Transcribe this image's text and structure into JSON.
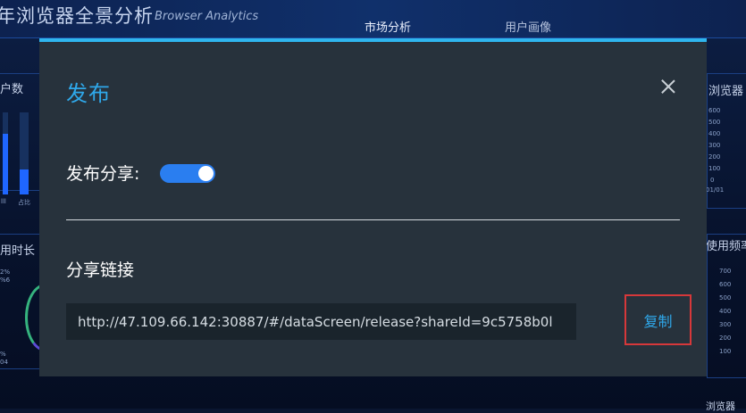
{
  "dashboard": {
    "title": "年浏览器全景分析",
    "subtitle": "Browser Analytics",
    "tabs": [
      {
        "label": "市场分析"
      },
      {
        "label": "用户画像"
      }
    ],
    "panels": {
      "left_top_title": "户数",
      "left_mid_title": "用时长",
      "right_top_title": "浏览器",
      "right_mid_title": "使用频率",
      "right_bottom_title": "浏览器"
    },
    "axis_labels": {
      "left_a": "lll",
      "left_b": "占比",
      "right_top": [
        "600",
        "500",
        "400",
        "300",
        "200",
        "100",
        "0"
      ],
      "right_date": "01/01",
      "right_mid": [
        "700",
        "600",
        "500",
        "400",
        "300",
        "200",
        "100"
      ],
      "left_pct_top": "2%",
      "left_pct_top2": "%6",
      "left_pct_bottom": "%",
      "left_pct_bottom2": "04"
    }
  },
  "modal": {
    "title": "发布",
    "share_toggle_label": "发布分享:",
    "share_enabled": true,
    "link_heading": "分享链接",
    "link_value": "http://47.109.66.142:30887/#/dataScreen/release?shareId=9c5758b0l",
    "copy_label": "复制"
  },
  "colors": {
    "modal_bg": "#27323c",
    "accent": "#2fa8ea",
    "toggle_on": "#2a7ef0",
    "highlight_border": "#d6383a"
  }
}
